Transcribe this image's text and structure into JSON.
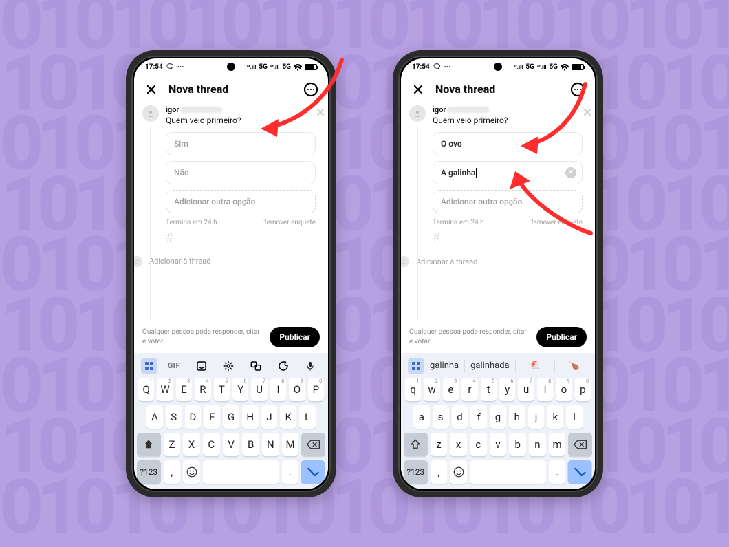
{
  "status": {
    "time": "17:54",
    "net": "5G",
    "sig_text": "ᵃᵗ.ıll"
  },
  "header": {
    "title": "Nova thread"
  },
  "user": {
    "name": "igor"
  },
  "screens": [
    {
      "question": "Quem veio primeiro?",
      "options": [
        {
          "text": "Sim",
          "placeholder": true
        },
        {
          "text": "Não",
          "placeholder": true
        }
      ],
      "add_option": "Adicionar outra opção",
      "ends": "Termina em 24 h",
      "remove": "Remover enquete",
      "add_thread": "Adicionar à thread",
      "footer_hint": "Qualquer pessoa pode responder, citar e votar",
      "publish": "Publicar",
      "kb_top": [
        "grid",
        "GIF",
        "sticker",
        "gear",
        "translate",
        "palette",
        "mic"
      ],
      "kb_rows": [
        [
          [
            "Q",
            "1"
          ],
          [
            "W",
            "2"
          ],
          [
            "E",
            "3"
          ],
          [
            "R",
            "4"
          ],
          [
            "T",
            "5"
          ],
          [
            "Y",
            "6"
          ],
          [
            "U",
            "7"
          ],
          [
            "I",
            "8"
          ],
          [
            "O",
            "9"
          ],
          [
            "P",
            "0"
          ]
        ],
        [
          "A",
          "S",
          "D",
          "F",
          "G",
          "H",
          "J",
          "K",
          "L"
        ],
        [
          "shift",
          "Z",
          "X",
          "C",
          "V",
          "B",
          "N",
          "M",
          "back"
        ],
        [
          "?123",
          ",",
          "emoji",
          "space",
          ".",
          "enter"
        ]
      ]
    },
    {
      "question": "Quem veio primeiro?",
      "options": [
        {
          "text": "O ovo",
          "placeholder": false
        },
        {
          "text": "A galinha",
          "placeholder": false,
          "cursor": true,
          "clear": true
        }
      ],
      "add_option": "Adicionar outra opção",
      "ends": "Termina em 24 h",
      "remove": "Remover enquete",
      "add_thread": "Adicionar à thread",
      "footer_hint": "Qualquer pessoa pode responder, citar e votar",
      "publish": "Publicar",
      "kb_suggestions": [
        "galinha",
        "galinhada"
      ],
      "kb_rows": [
        [
          [
            "q",
            "1"
          ],
          [
            "w",
            "2"
          ],
          [
            "e",
            "3"
          ],
          [
            "r",
            "4"
          ],
          [
            "t",
            "5"
          ],
          [
            "y",
            "6"
          ],
          [
            "u",
            "7"
          ],
          [
            "i",
            "8"
          ],
          [
            "o",
            "9"
          ],
          [
            "p",
            "0"
          ]
        ],
        [
          "a",
          "s",
          "d",
          "f",
          "g",
          "h",
          "j",
          "k",
          "l"
        ],
        [
          "shift",
          "z",
          "x",
          "c",
          "v",
          "b",
          "n",
          "m",
          "back"
        ],
        [
          "?123",
          ",",
          "emoji",
          "space",
          ".",
          "enter"
        ]
      ]
    }
  ]
}
